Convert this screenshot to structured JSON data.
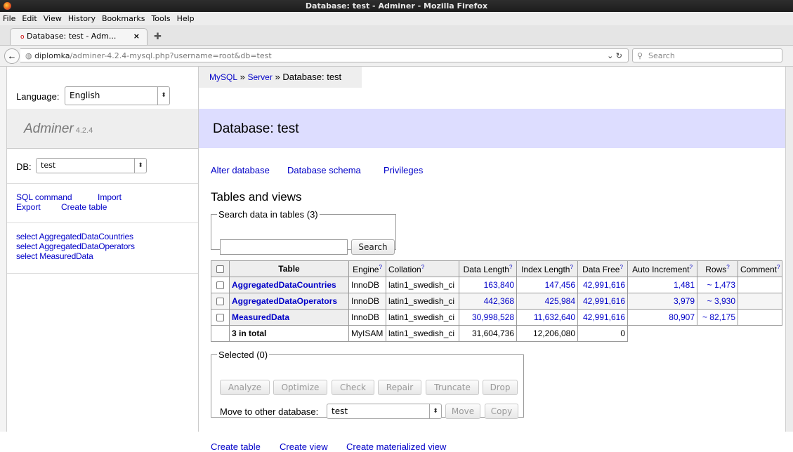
{
  "window": {
    "title": "Database: test - Adminer - Mozilla Firefox"
  },
  "browser": {
    "menu": [
      "File",
      "Edit",
      "View",
      "History",
      "Bookmarks",
      "Tools",
      "Help"
    ],
    "tab_title": "Database: test - Adm...",
    "url_host": "diplomka",
    "url_path": "/adminer-4.2.4-mysql.php?username=root&db=test",
    "search_placeholder": "Search"
  },
  "sidebar": {
    "language_label": "Language:",
    "language_value": "English",
    "brand": "Adminer",
    "version": "4.2.4",
    "db_label": "DB:",
    "db_value": "test",
    "links": {
      "sql": "SQL command",
      "import": "Import",
      "export": "Export",
      "create_table": "Create table"
    },
    "tables": [
      "select AggregatedDataCountries",
      "select AggregatedDataOperators",
      "select MeasuredData"
    ]
  },
  "breadcrumb": {
    "mysql": "MySQL",
    "server": "Server",
    "current": "Database: test",
    "sep": "»"
  },
  "page_title": "Database: test",
  "db_links": {
    "alter": "Alter database",
    "schema": "Database schema",
    "privileges": "Privileges"
  },
  "section_title": "Tables and views",
  "search": {
    "legend": "Search data in tables (3)",
    "button": "Search",
    "value": ""
  },
  "table": {
    "headers": {
      "table": "Table",
      "engine": "Engine",
      "collation": "Collation",
      "data_length": "Data Length",
      "index_length": "Index Length",
      "data_free": "Data Free",
      "auto_increment": "Auto Increment",
      "rows": "Rows",
      "comment": "Comment"
    },
    "help_mark": "?",
    "rows": [
      {
        "name": "AggregatedDataCountries",
        "engine": "InnoDB",
        "collation": "latin1_swedish_ci",
        "data_length": "163,840",
        "index_length": "147,456",
        "data_free": "42,991,616",
        "auto_increment": "1,481",
        "rows": "~ 1,473",
        "comment": ""
      },
      {
        "name": "AggregatedDataOperators",
        "engine": "InnoDB",
        "collation": "latin1_swedish_ci",
        "data_length": "442,368",
        "index_length": "425,984",
        "data_free": "42,991,616",
        "auto_increment": "3,979",
        "rows": "~ 3,930",
        "comment": ""
      },
      {
        "name": "MeasuredData",
        "engine": "InnoDB",
        "collation": "latin1_swedish_ci",
        "data_length": "30,998,528",
        "index_length": "11,632,640",
        "data_free": "42,991,616",
        "auto_increment": "80,907",
        "rows": "~ 82,175",
        "comment": ""
      }
    ],
    "total": {
      "label": "3 in total",
      "engine": "MyISAM",
      "collation": "latin1_swedish_ci",
      "data_length": "31,604,736",
      "index_length": "12,206,080",
      "data_free": "0"
    }
  },
  "selected": {
    "legend": "Selected (0)",
    "buttons": {
      "analyze": "Analyze",
      "optimize": "Optimize",
      "check": "Check",
      "repair": "Repair",
      "truncate": "Truncate",
      "drop": "Drop"
    },
    "move_label": "Move to other database:",
    "move_value": "test",
    "move_button": "Move",
    "copy_button": "Copy"
  },
  "bottom_links": {
    "create_table": "Create table",
    "create_view": "Create view",
    "create_mview": "Create materialized view"
  }
}
